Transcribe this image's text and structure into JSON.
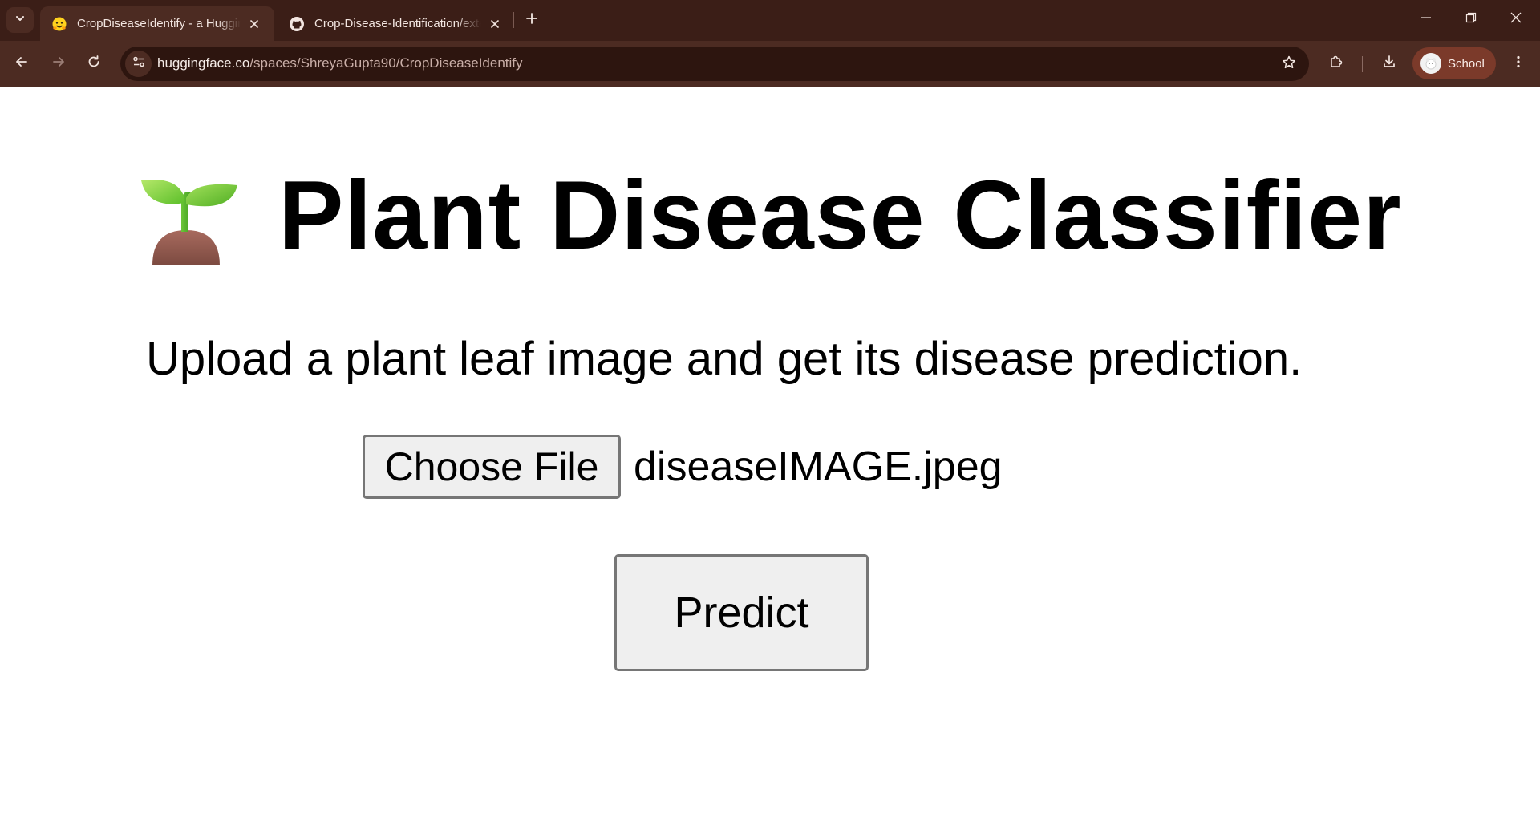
{
  "browser": {
    "tabs": [
      {
        "title": "CropDiseaseIdentify - a Hugging Face Space",
        "active": true,
        "favicon": "hugging-face-icon"
      },
      {
        "title": "Crop-Disease-Identification/extension",
        "active": false,
        "favicon": "github-icon"
      }
    ],
    "address": {
      "host": "huggingface.co",
      "path": "/spaces/ShreyaGupta90/CropDiseaseIdentify"
    },
    "profile": {
      "label": "School"
    },
    "theme_colors": {
      "tabbar": "#3b1e17",
      "toolbar": "#4c2b22",
      "omnibox": "#2d150f",
      "profile_chip": "#7b3a2a"
    }
  },
  "page": {
    "title_icon": "seedling-icon",
    "title": "Plant Disease Classifier",
    "description": "Upload a plant leaf image and get its disease prediction.",
    "file_input": {
      "button_label": "Choose File",
      "selected_file": "diseaseIMAGE.jpeg"
    },
    "predict_label": "Predict"
  }
}
